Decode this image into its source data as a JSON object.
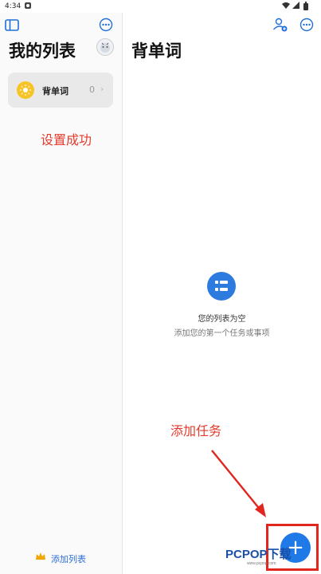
{
  "status": {
    "time": "4:34"
  },
  "left": {
    "title": "我的列表",
    "list": {
      "name": "背单词",
      "count": "0"
    },
    "annotation": "设置成功",
    "add_list": "添加列表"
  },
  "right": {
    "title": "背单词",
    "empty": {
      "title": "您的列表为空",
      "subtitle": "添加您的第一个任务或事项"
    },
    "annotation": "添加任务"
  },
  "watermark": {
    "brand": "PCPOP下载",
    "sub": "www.pcpop.com"
  },
  "colors": {
    "accent": "#2e7be0",
    "annotation": "#e23b2c",
    "sun": "#f7c325"
  },
  "icons": [
    "sidebar-toggle-icon",
    "more-icon",
    "avatar",
    "sun-icon",
    "share-person-icon",
    "list-icon",
    "plus-icon",
    "crown-icon"
  ]
}
